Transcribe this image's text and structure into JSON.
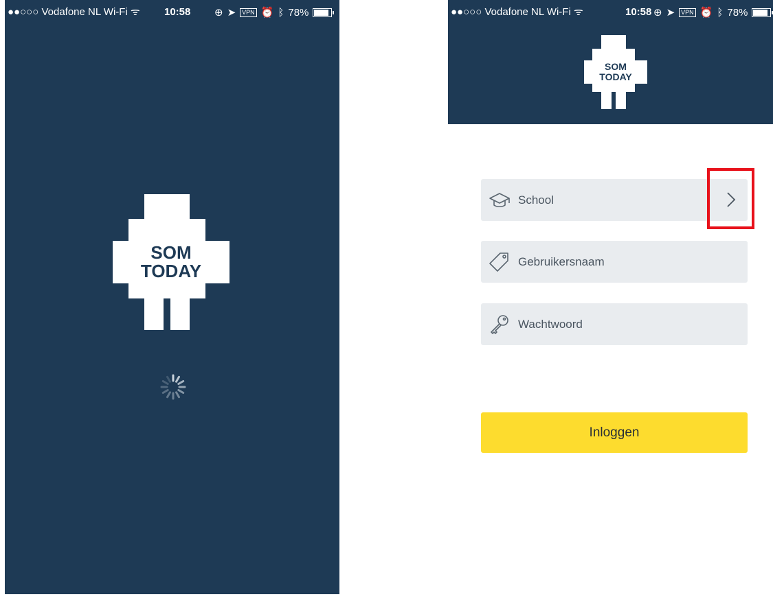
{
  "status_bar": {
    "carrier": "●●○○○ Vodafone NL Wi-Fi ᯤ",
    "time": "10:58",
    "vpn": "VPN",
    "battery": "78%"
  },
  "logo": {
    "line1": "SOM",
    "line2": "TODAY"
  },
  "login_form": {
    "school_label": "School",
    "username_label": "Gebruikersnaam",
    "password_label": "Wachtwoord",
    "login_button": "Inloggen"
  },
  "colors": {
    "brand_navy": "#1e3a55",
    "button_yellow": "#fddc2e",
    "field_gray": "#e9ecef",
    "highlight_red": "#e8121b"
  },
  "icons": {
    "school": "graduation-cap-icon",
    "username": "tag-icon",
    "password": "key-icon",
    "chevron": "chevron-right-icon"
  }
}
